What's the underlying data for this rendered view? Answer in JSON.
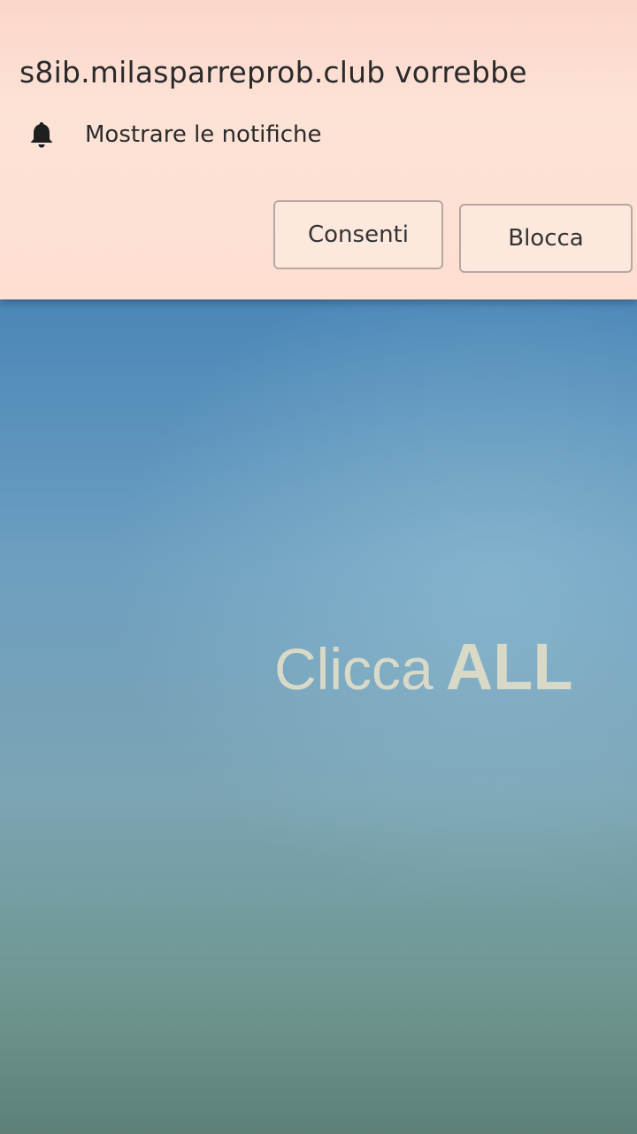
{
  "notification_prompt": {
    "title": "s8ib.milasparreprob.club vorrebbe",
    "permission": {
      "icon": "bell-icon",
      "text": "Mostrare le notifiche"
    },
    "allow_label": "Consenti",
    "block_label": "Blocca"
  },
  "page": {
    "headline_prefix": "Clicca",
    "headline_emphasis": "ALL"
  },
  "colors": {
    "prompt_background": "#fde0d2",
    "page_blue": "#4a86b8",
    "page_bottom": "#5c8078",
    "headline_text": "#d9d9c8"
  }
}
